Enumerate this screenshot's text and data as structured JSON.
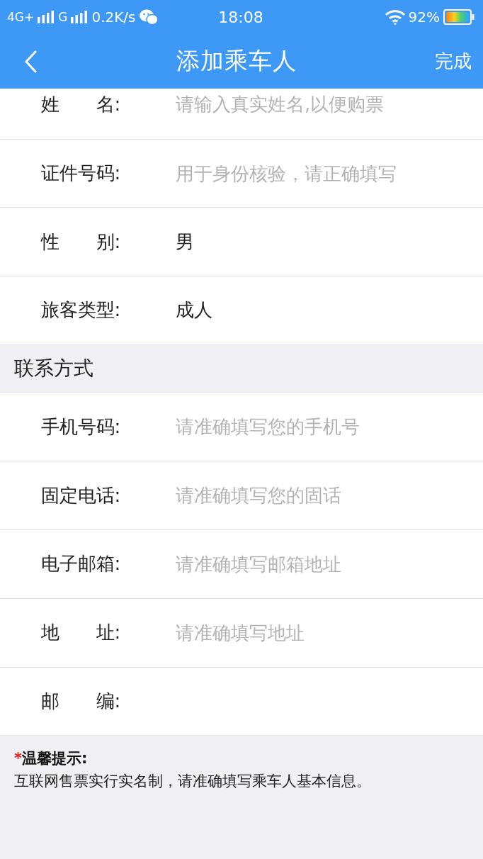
{
  "status_bar": {
    "network_primary": "4G+",
    "network_secondary": "G",
    "speed": "0.2K/s",
    "time": "18:08",
    "battery": "92%"
  },
  "nav_bar": {
    "title": "添加乘车人",
    "action": "完成"
  },
  "passenger_fields": [
    {
      "label": "姓　　名:",
      "placeholder": "请输入真实姓名,以便购票"
    },
    {
      "label": "证件号码:",
      "placeholder": "用于身份核验，请正确填写"
    },
    {
      "label": "性　　别:",
      "value": "男"
    },
    {
      "label": "旅客类型:",
      "value": "成人"
    }
  ],
  "contact_section": {
    "title": "联系方式",
    "fields": [
      {
        "label": "手机号码:",
        "placeholder": "请准确填写您的手机号"
      },
      {
        "label": "固定电话:",
        "placeholder": "请准确填写您的固话"
      },
      {
        "label": "电子邮箱:",
        "placeholder": "请准确填写邮箱地址"
      },
      {
        "label": "地　　址:",
        "placeholder": "请准确填写地址"
      },
      {
        "label": "邮　　编:"
      }
    ]
  },
  "notice": {
    "mark": "*",
    "title": "温馨提示:",
    "text": "互联网售票实行实名制，请准确填写乘车人基本信息。"
  }
}
